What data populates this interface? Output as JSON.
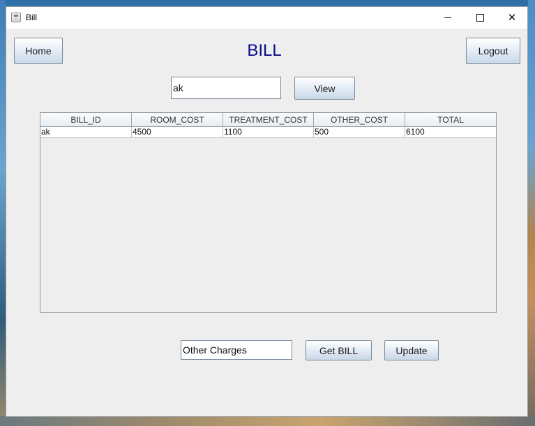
{
  "window": {
    "title": "Bill",
    "icon": "java-cup-icon"
  },
  "header": {
    "heading": "BILL",
    "heading_color": "#0a0a8a",
    "home_label": "Home",
    "logout_label": "Logout"
  },
  "search": {
    "value": "ak",
    "view_label": "View"
  },
  "table": {
    "columns": [
      "BILL_ID",
      "ROOM_COST",
      "TREATMENT_COST",
      "OTHER_COST",
      "TOTAL"
    ],
    "rows": [
      [
        "ak",
        "4500",
        "1100",
        "500",
        "6100"
      ]
    ]
  },
  "footer": {
    "other_charges_value": "Other Charges",
    "get_bill_label": "Get BILL",
    "update_label": "Update"
  }
}
